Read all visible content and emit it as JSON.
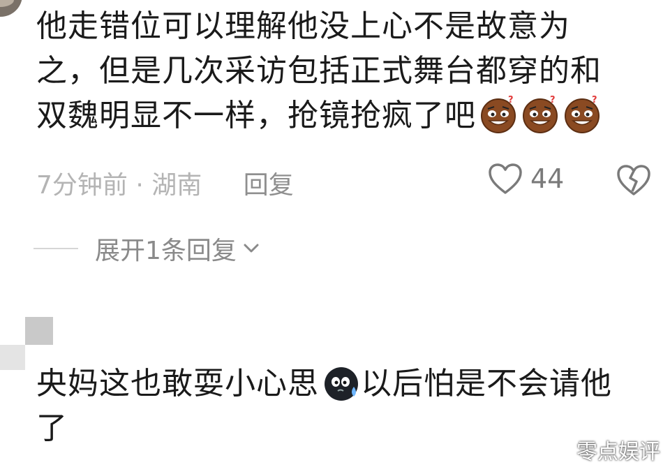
{
  "comment1": {
    "line1": "他走错位可以理解他没上心不是故意为",
    "line2": "之，但是几次采访包括正式舞台都穿的和",
    "line3": "双魏明显不一样，抢镜抢疯了吧",
    "emojis": [
      "sweat-grin-emoji",
      "sweat-grin-emoji",
      "sweat-grin-emoji"
    ],
    "time_location": "7分钟前 · 湖南",
    "reply_label": "回复",
    "like_count": "44",
    "expand_label": "展开1条回复"
  },
  "comment2": {
    "text_before": "央妈这也敢耍小心思",
    "emoji": "dark-sweat-emoji",
    "text_after": "以后怕是不会请他",
    "line2": "了"
  },
  "watermark": "零点娱评",
  "colors": {
    "text": "#1a1a1a",
    "meta": "#b4b4b4",
    "icon": "#7a7a7a"
  }
}
